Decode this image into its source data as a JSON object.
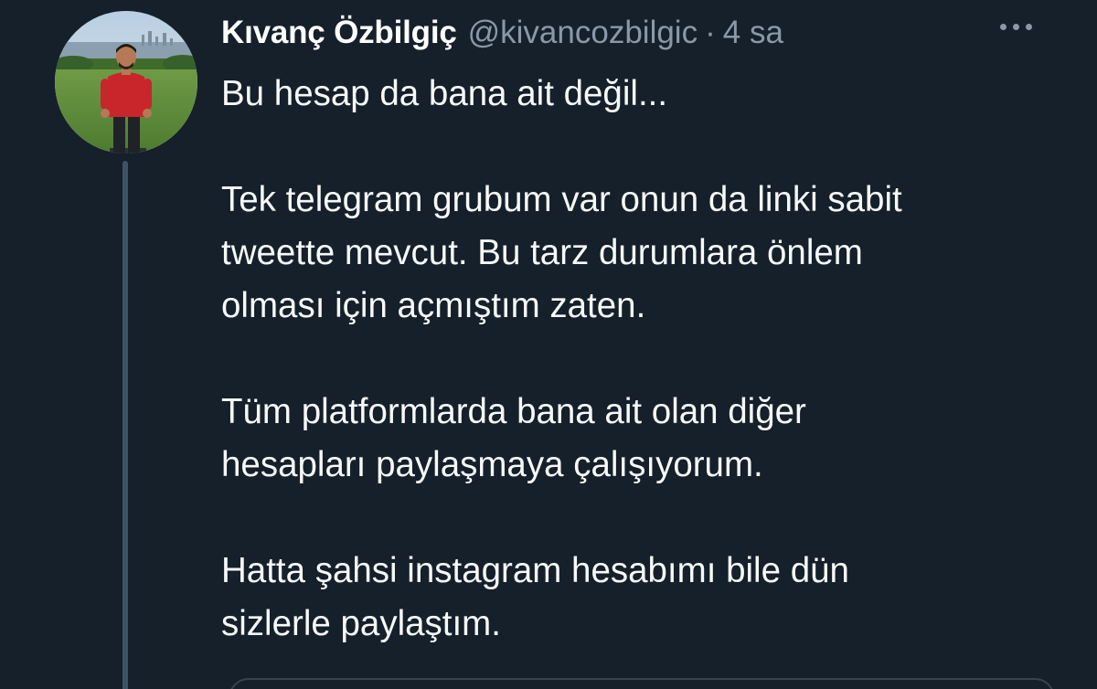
{
  "tweet": {
    "author": {
      "display_name": "Kıvanç Özbilgiç",
      "handle": "@kivancozbilgic"
    },
    "separator": "·",
    "timestamp": "4 sa",
    "more_icon": "more-horizontal-icon",
    "paragraphs": [
      [
        "Bu hesap da bana ait değil..."
      ],
      [
        "Tek telegram grubum var onun da linki sabit",
        "tweette mevcut. Bu tarz durumlara önlem",
        "olması için açmıştım zaten."
      ],
      [
        "Tüm platformlarda bana ait olan diğer",
        "hesapları paylaşmaya çalışıyorum."
      ],
      [
        "Hatta şahsi instagram hesabımı bile dün",
        "sizlerle paylaştım."
      ]
    ]
  },
  "colors": {
    "background": "#15202b",
    "primary_text": "#f7f9f9",
    "secondary_text": "#8b98a5",
    "thread_line": "#3d5466",
    "border": "#38444d"
  }
}
